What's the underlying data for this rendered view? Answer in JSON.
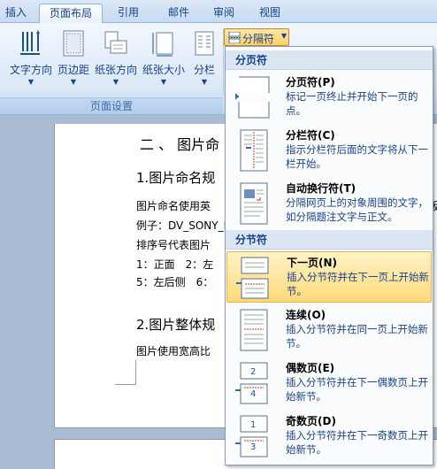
{
  "tabs": [
    "插入",
    "页面布局",
    "引用",
    "邮件",
    "审阅",
    "视图"
  ],
  "active_tab_index": 1,
  "ribbon": {
    "buttons": [
      {
        "label": "文字方向",
        "icon": "text-direction-icon"
      },
      {
        "label": "页边距",
        "icon": "margins-icon"
      },
      {
        "label": "纸张方向",
        "icon": "orientation-icon"
      },
      {
        "label": "纸张大小",
        "icon": "size-icon"
      },
      {
        "label": "分栏",
        "icon": "columns-icon"
      }
    ],
    "breaks_label": "分隔符",
    "group_label": "页面设置"
  },
  "document": {
    "heading2": "二 、 图片命",
    "heading3a": "1.图片命名规",
    "line1": "图片命名使用英",
    "line1_end": "版",
    "line2": "例子：DV_SONY_I",
    "line3": "排序号代表图片",
    "line4": "1：正面　2：左",
    "line5": "5：左后侧　6：",
    "heading3b": "2.图片整体规",
    "line6": "图片使用宽高比"
  },
  "menu": {
    "section1": "分页符",
    "section2": "分节符",
    "items": [
      {
        "title": "分页符(P)",
        "desc": "标记一页终止并开始下一页的点。",
        "icon": "page-break-icon"
      },
      {
        "title": "分栏符(C)",
        "desc": "指示分栏符后面的文字将从下一栏开始。",
        "icon": "column-break-icon"
      },
      {
        "title": "自动换行符(T)",
        "desc": "分隔网页上的对象周围的文字，如分隔题注文字与正文。",
        "icon": "text-wrapping-break-icon"
      },
      {
        "title": "下一页(N)",
        "desc": "插入分节符并在下一页上开始新节。",
        "icon": "next-page-section-icon"
      },
      {
        "title": "连续(O)",
        "desc": "插入分节符并在同一页上开始新节。",
        "icon": "continuous-section-icon"
      },
      {
        "title": "偶数页(E)",
        "desc": "插入分节符并在下一偶数页上开始新节。",
        "icon": "even-page-section-icon"
      },
      {
        "title": "奇数页(D)",
        "desc": "插入分节符并在下一奇数页上开始新节。",
        "icon": "odd-page-section-icon"
      }
    ],
    "highlighted_index": 3
  },
  "colors": {
    "accent": "#15428b",
    "highlight": "#fed97a",
    "ribbon_bg": "#dbe8f7"
  }
}
